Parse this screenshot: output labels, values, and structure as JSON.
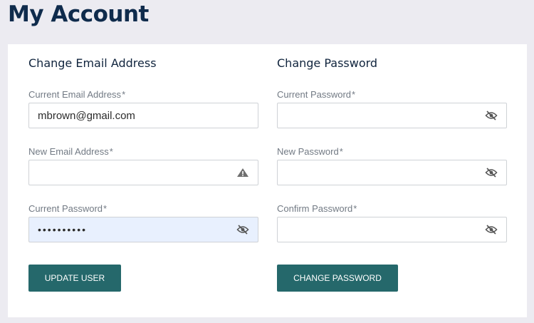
{
  "page": {
    "title": "My Account"
  },
  "email_section": {
    "title": "Change Email Address",
    "fields": [
      {
        "label": "Current Email Address",
        "required": "*",
        "value": "mbrown@gmail.com",
        "placeholder": "",
        "icon": ""
      },
      {
        "label": "New Email Address",
        "required": "*",
        "value": "",
        "placeholder": "",
        "icon": "warning-icon"
      },
      {
        "label": "Current Password",
        "required": "*",
        "value": "••••••••••",
        "placeholder": "",
        "icon": "eye-off-icon"
      }
    ],
    "button_label": "UPDATE USER"
  },
  "password_section": {
    "title": "Change Password",
    "fields": [
      {
        "label": "Current Password",
        "required": "*",
        "value": "",
        "placeholder": "",
        "icon": "eye-off-icon"
      },
      {
        "label": "New Password",
        "required": "*",
        "value": "",
        "placeholder": "",
        "icon": "eye-off-icon"
      },
      {
        "label": "Confirm Password",
        "required": "*",
        "value": "",
        "placeholder": "",
        "icon": "eye-off-icon"
      }
    ],
    "button_label": "CHANGE PASSWORD"
  },
  "colors": {
    "background": "#ecebf1",
    "title": "#0f2b4c",
    "button": "#25686b",
    "autofill": "#e8f0fe"
  }
}
